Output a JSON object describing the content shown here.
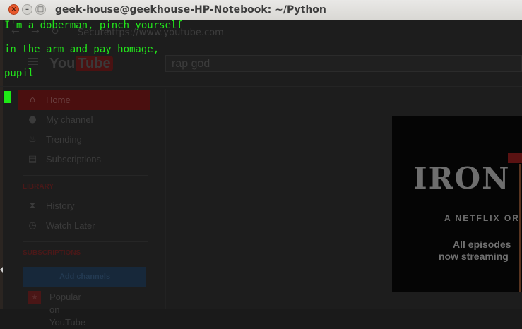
{
  "window": {
    "title": "geek-house@geekhouse-HP-Notebook: ~/Python",
    "close_glyph": "×",
    "min_glyph": "–",
    "max_glyph": "□"
  },
  "terminal": {
    "lines": [
      "I'm a doberman, pinch yourself",
      "in the arm and pay homage,",
      "pupil"
    ],
    "text_color": "#22e51b"
  },
  "browser": {
    "secure_label": "Secure",
    "url": "https://www.youtube.com",
    "search_value": "rap god",
    "logo_you": "You",
    "logo_tube": "Tube"
  },
  "sidebar": {
    "items": [
      {
        "label": "Home",
        "icon": "home-icon",
        "glyph": "⌂"
      },
      {
        "label": "My channel",
        "icon": "user-icon",
        "glyph": "●"
      },
      {
        "label": "Trending",
        "icon": "flame-icon",
        "glyph": "♨"
      },
      {
        "label": "Subscriptions",
        "icon": "subscriptions-icon",
        "glyph": "▤"
      }
    ],
    "library_heading": "LIBRARY",
    "library_items": [
      {
        "label": "History",
        "icon": "hourglass-icon",
        "glyph": "⧗"
      },
      {
        "label": "Watch Later",
        "icon": "clock-icon",
        "glyph": "◷"
      }
    ],
    "subscriptions_heading": "SUBSCRIPTIONS",
    "add_channels_label": "Add channels",
    "popular_label": "Popular on YouTube",
    "popular_glyph": "★"
  },
  "ad": {
    "logo_text": "IRON",
    "subtitle": "A NETFLIX OR",
    "line1": "All episodes",
    "line2": "now streaming"
  }
}
